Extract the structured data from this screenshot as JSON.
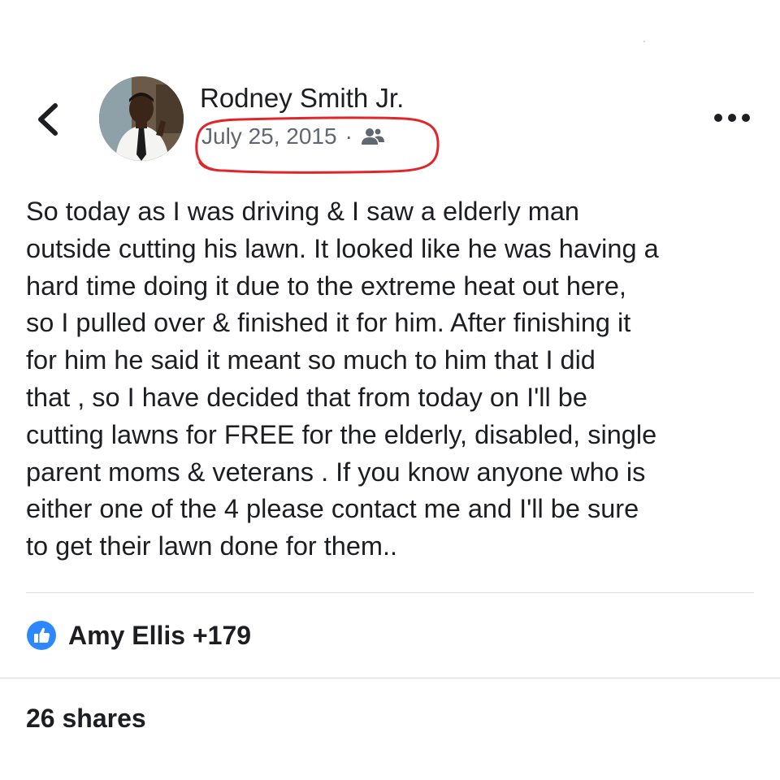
{
  "post": {
    "author_name": "Rodney Smith Jr.",
    "date": "July 25, 2015",
    "separator": "·",
    "audience_icon": "friends-icon",
    "body": "So today as I was driving & I saw a elderly man\noutside cutting his lawn. It looked like he was having a\nhard time doing it due to the extreme heat out here,\nso I pulled over & finished it for him. After finishing it\nfor him he said it meant so much to him that I did\nthat , so I have decided that from today on I'll be\ncutting lawns for FREE for the elderly, disabled, single\nparent moms & veterans . If you know anyone who is\neither one of the 4 please contact me and I'll be sure\nto get their lawn done for them.."
  },
  "reactions": {
    "icon": "like-icon",
    "text": "Amy Ellis +179"
  },
  "shares": {
    "text": "26 shares"
  },
  "colors": {
    "highlight_circle": "#e0262b",
    "like_blue": "#2d88ff",
    "secondary_text": "#606770"
  }
}
